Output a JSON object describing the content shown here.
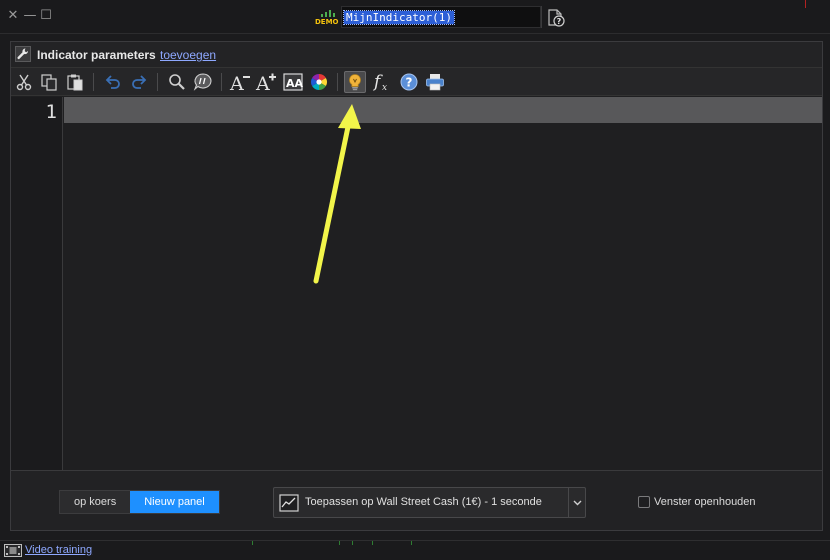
{
  "window": {
    "close_glyph": "✕",
    "minimize_glyph": "—",
    "maximize_glyph": "☐",
    "demo_badge": "DEMO",
    "indicator_name": "MijnIndicator(1)",
    "help_icon": "document-help-icon"
  },
  "params_bar": {
    "label": "Indicator parameters",
    "add_link": "toevoegen",
    "icon": "wrench-icon"
  },
  "toolbar": {
    "buttons": [
      {
        "icon": "cut-icon"
      },
      {
        "icon": "copy-icon"
      },
      {
        "icon": "paste-icon"
      },
      {
        "icon": "undo-icon"
      },
      {
        "icon": "redo-icon"
      },
      {
        "icon": "search-icon"
      },
      {
        "icon": "comment-icon"
      },
      {
        "icon": "decrease-font-icon"
      },
      {
        "icon": "increase-font-icon"
      },
      {
        "icon": "font-style-icon"
      },
      {
        "icon": "color-wheel-icon"
      },
      {
        "icon": "lightbulb-icon",
        "active": true
      },
      {
        "icon": "function-icon"
      },
      {
        "icon": "help-icon"
      },
      {
        "icon": "print-icon"
      }
    ]
  },
  "editor": {
    "line_numbers": [
      "1"
    ],
    "code": ""
  },
  "bottom": {
    "mode_buttons": [
      {
        "label": "op koers",
        "selected": false
      },
      {
        "label": "Nieuw panel",
        "selected": true
      }
    ],
    "apply_text": "Toepassen op Wall Street Cash (1€) - 1 seconde",
    "keep_open_label": "Venster openhouden",
    "keep_open_checked": false
  },
  "statusbar": {
    "video_link": "Video training"
  },
  "colors": {
    "accent": "#1e90ff",
    "link": "#8ea8ff",
    "annotation_arrow": "#f2f54a",
    "selection": "#2d5fd6"
  }
}
